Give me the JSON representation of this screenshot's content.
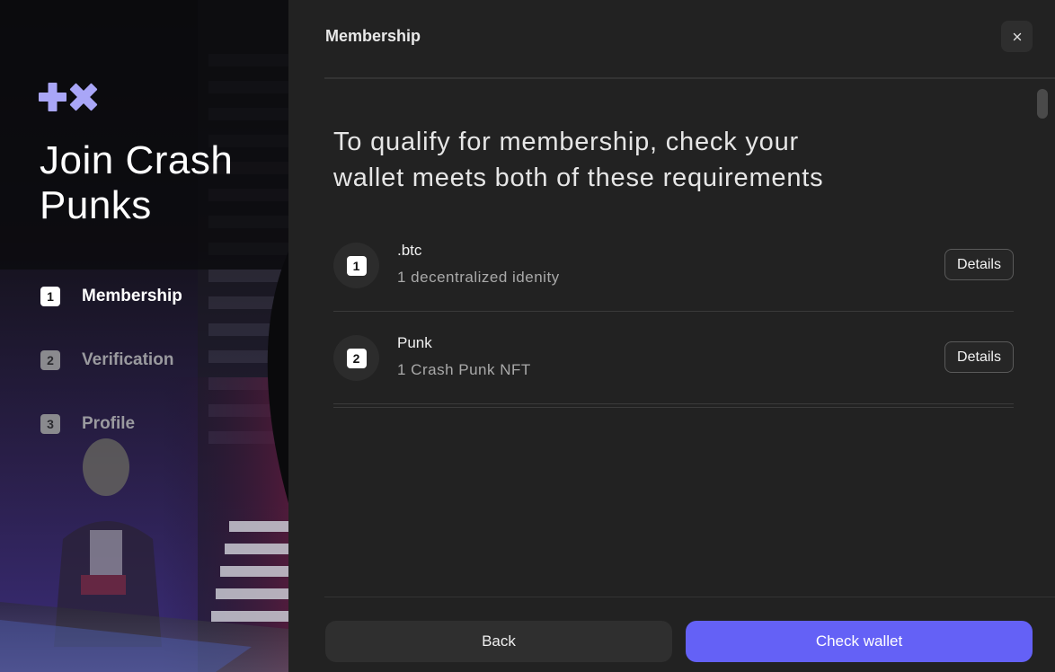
{
  "sidebar": {
    "logo_icon": "plus-x-logo-icon",
    "title": "Join Crash Punks",
    "steps": [
      {
        "number": "1",
        "label": "Membership",
        "active": true
      },
      {
        "number": "2",
        "label": "Verification",
        "active": false
      },
      {
        "number": "3",
        "label": "Profile",
        "active": false
      }
    ]
  },
  "dialog": {
    "title": "Membership",
    "close_icon": "close-icon",
    "intro": "To qualify for membership, check your wallet meets both of these requirements",
    "requirements": [
      {
        "number": "1",
        "name": ".btc",
        "description": "1 decentralized idenity",
        "details_label": "Details"
      },
      {
        "number": "2",
        "name": "Punk",
        "description": "1 Crash Punk NFT",
        "details_label": "Details"
      }
    ],
    "back_label": "Back",
    "check_label": "Check wallet"
  },
  "colors": {
    "accent": "#6461f6",
    "panel_bg": "#222222",
    "logo": "#a9a6f7"
  }
}
